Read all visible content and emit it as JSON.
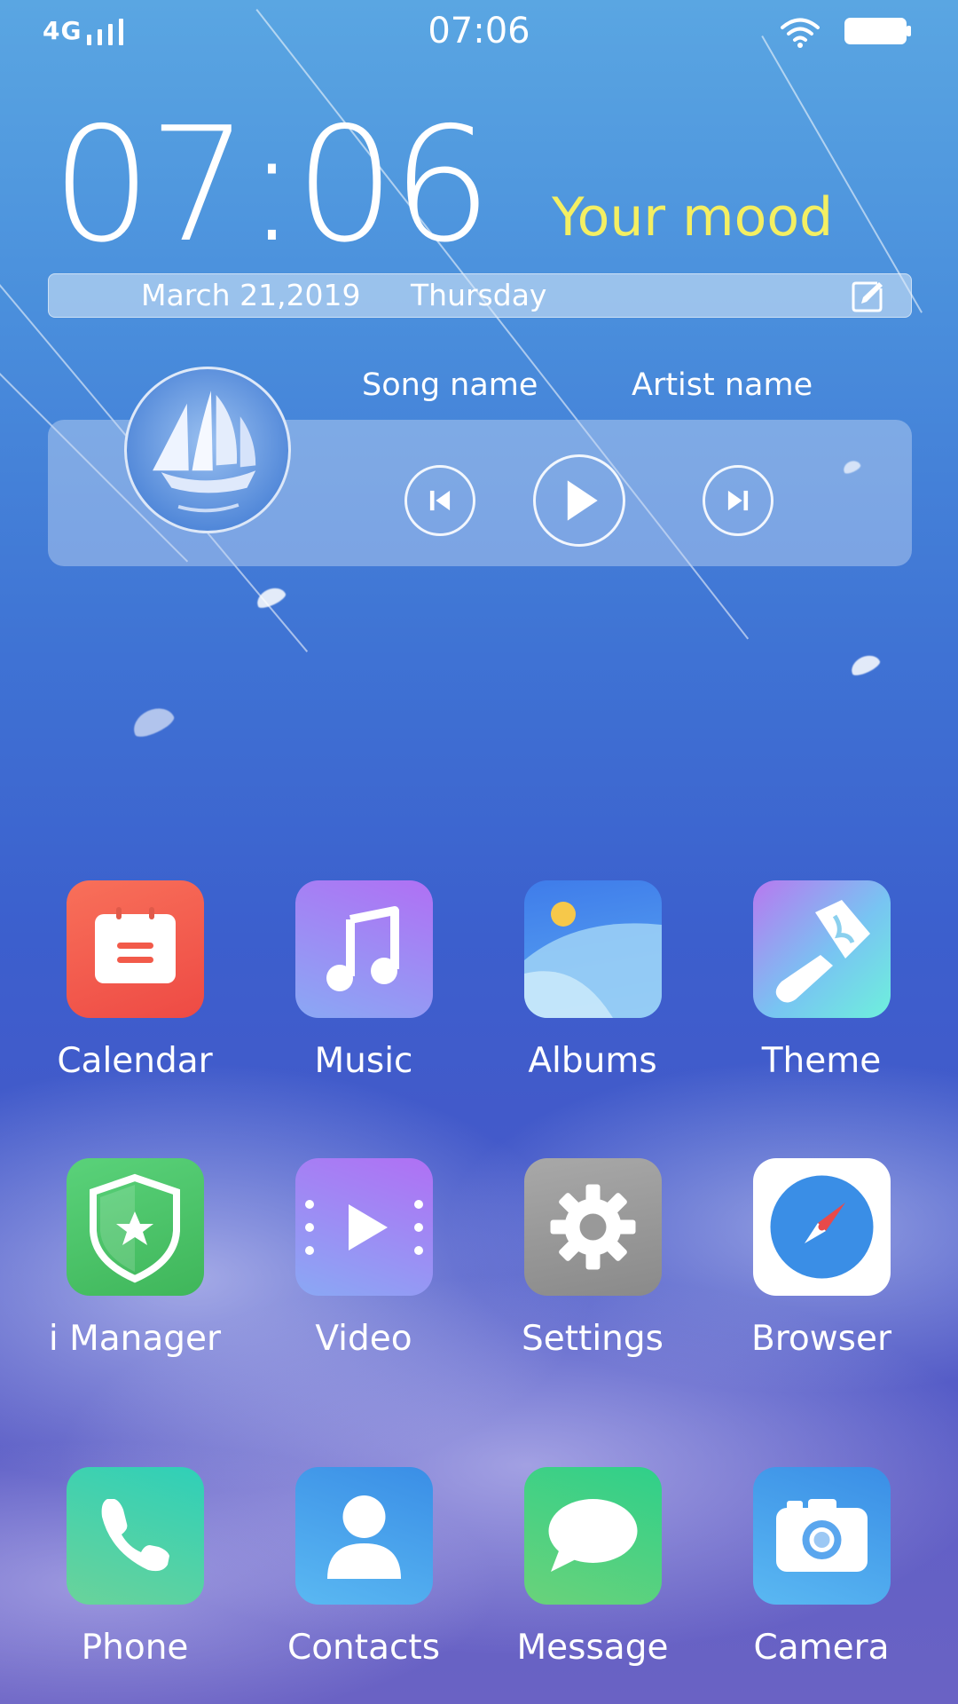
{
  "status_bar": {
    "network": "4G",
    "time": "07:06"
  },
  "clock_widget": {
    "time": "07:06",
    "mood": "Your mood",
    "date": "March 21,2019",
    "weekday": "Thursday"
  },
  "music_widget": {
    "song": "Song name",
    "artist": "Artist name"
  },
  "apps": [
    {
      "label": "Calendar",
      "icon": "calendar-icon"
    },
    {
      "label": "Music",
      "icon": "music-note-icon"
    },
    {
      "label": "Albums",
      "icon": "albums-icon"
    },
    {
      "label": "Theme",
      "icon": "paintbrush-icon"
    },
    {
      "label": "i Manager",
      "icon": "shield-star-icon"
    },
    {
      "label": "Video",
      "icon": "video-play-icon"
    },
    {
      "label": "Settings",
      "icon": "gear-icon"
    },
    {
      "label": "Browser",
      "icon": "compass-icon"
    },
    {
      "label": "Phone",
      "icon": "phone-icon"
    },
    {
      "label": "Contacts",
      "icon": "person-icon"
    },
    {
      "label": "Message",
      "icon": "chat-bubble-icon"
    },
    {
      "label": "Camera",
      "icon": "camera-icon"
    }
  ],
  "colors": {
    "mood_text": "#f4ef62",
    "calendar": "#f25a4a",
    "music": "#9a7cf2",
    "albums": "#4f9cf0",
    "theme": "#9fd6f0",
    "imanager": "#4fc46a",
    "video": "#9b7af2",
    "settings": "#9a9a9a",
    "browser": "#ffffff",
    "phone": "#3fd1a8",
    "contacts": "#4aa4ee",
    "message": "#3fce7a",
    "camera": "#4aa8ee"
  }
}
